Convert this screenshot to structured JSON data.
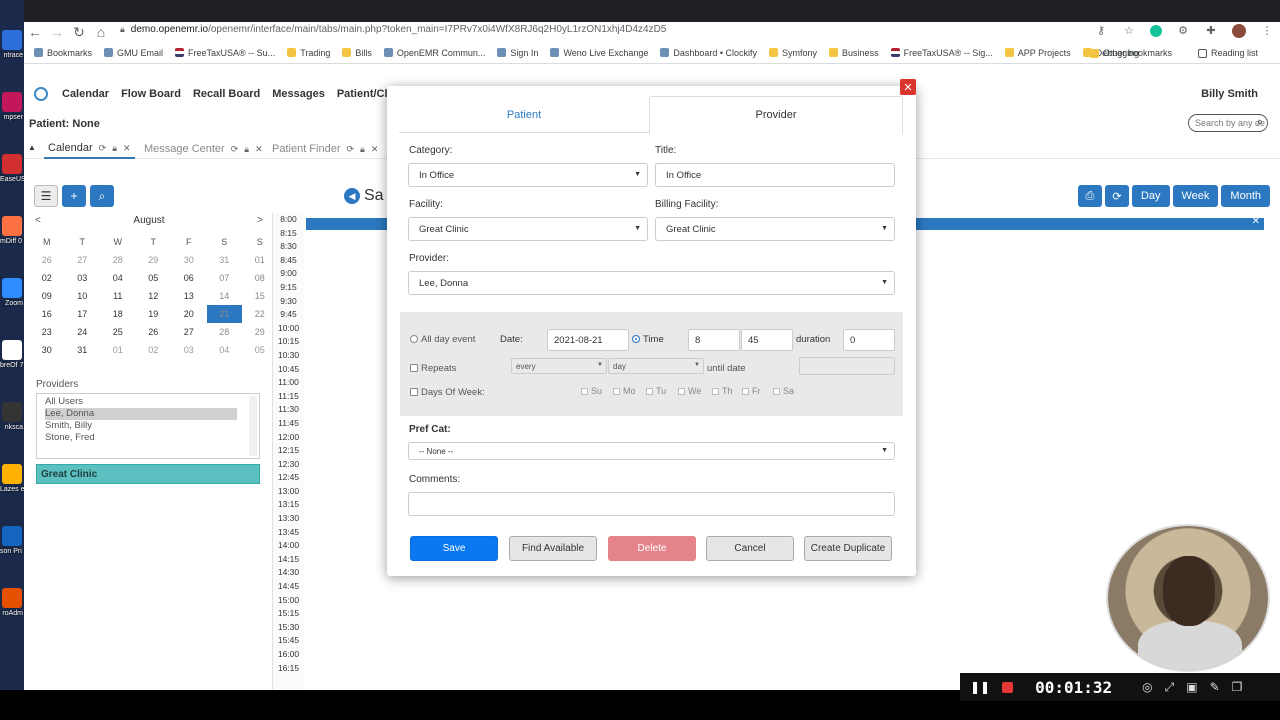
{
  "browser": {
    "url_host": "demo.openemr.io",
    "url_path": "/openemr/interface/main/tabs/main.php?token_main=I7PRv7x0i4WfX8RJ6q2H0yL1rzON1xhj4D4z4zD5",
    "bookmarks": [
      {
        "label": "Bookmarks",
        "icon": "apps-icon"
      },
      {
        "label": "GMU Email",
        "icon": "globe-icon"
      },
      {
        "label": "FreeTaxUSA® -- Su...",
        "icon": "flag-icon"
      },
      {
        "label": "Trading",
        "icon": "folder-icon"
      },
      {
        "label": "Bills",
        "icon": "folder-icon"
      },
      {
        "label": "OpenEMR Commun...",
        "icon": "openemr-icon"
      },
      {
        "label": "Sign In",
        "icon": "gear-icon"
      },
      {
        "label": "Weno Live Exchange",
        "icon": "weno-icon"
      },
      {
        "label": "Dashboard • Clockify",
        "icon": "clockify-icon"
      },
      {
        "label": "Symfony",
        "icon": "folder-icon"
      },
      {
        "label": "Business",
        "icon": "folder-icon"
      },
      {
        "label": "FreeTaxUSA® -- Sig...",
        "icon": "flag-icon"
      },
      {
        "label": "APP Projects",
        "icon": "folder-icon"
      },
      {
        "label": "Debugging",
        "icon": "folder-icon"
      }
    ],
    "other_bookmarks": "Other bookmarks",
    "reading_list": "Reading list"
  },
  "desktop": {
    "icons": [
      "ntrace",
      "mpser",
      "EaseUS\necExpe",
      "mDiff\n0 (64-",
      "Zoom",
      "breOf\n7.1",
      "nksca",
      "Lazes\necover",
      "son Pri\nnnect",
      "roAdm"
    ]
  },
  "app": {
    "menu": [
      "Calendar",
      "Flow Board",
      "Recall Board",
      "Messages",
      "Patient/Client"
    ],
    "user": "Billy Smith",
    "patient": "Patient: None",
    "search_placeholder": "Search by any de",
    "tabs": [
      {
        "label": "Calendar",
        "active": true
      },
      {
        "label": "Message Center",
        "active": false
      },
      {
        "label": "Patient Finder",
        "active": false
      }
    ],
    "day_title": "Sa",
    "view_buttons": [
      "Day",
      "Week",
      "Month"
    ],
    "mini_calendar": {
      "prev": "<",
      "next": ">",
      "month": "August",
      "dow": [
        "M",
        "T",
        "W",
        "T",
        "F",
        "S",
        "S"
      ],
      "weeks": [
        [
          "26",
          "27",
          "28",
          "29",
          "30",
          "31",
          "01"
        ],
        [
          "02",
          "03",
          "04",
          "05",
          "06",
          "07",
          "08"
        ],
        [
          "09",
          "10",
          "11",
          "12",
          "13",
          "14",
          "15"
        ],
        [
          "16",
          "17",
          "18",
          "19",
          "20",
          "21",
          "22"
        ],
        [
          "23",
          "24",
          "25",
          "26",
          "27",
          "28",
          "29"
        ],
        [
          "30",
          "31",
          "01",
          "02",
          "03",
          "04",
          "05"
        ]
      ],
      "selected": "21"
    },
    "providers_label": "Providers",
    "providers": [
      "All Users",
      "Lee, Donna",
      "Smith, Billy",
      "Stone, Fred"
    ],
    "selected_provider": "Lee, Donna",
    "facility": "Great Clinic",
    "times": [
      "8:00",
      "8:15",
      "8:30",
      "8:45",
      "9:00",
      "9:15",
      "9:30",
      "9:45",
      "10:00",
      "10:15",
      "10:30",
      "10:45",
      "11:00",
      "11:15",
      "11:30",
      "11:45",
      "12:00",
      "12:15",
      "12:30",
      "12:45",
      "13:00",
      "13:15",
      "13:30",
      "13:45",
      "14:00",
      "14:15",
      "14:30",
      "14:45",
      "15:00",
      "15:15",
      "15:30",
      "15:45",
      "16:00",
      "16:15"
    ]
  },
  "modal": {
    "tab_patient": "Patient",
    "tab_provider": "Provider",
    "category_label": "Category:",
    "category_value": "In Office",
    "title_label": "Title:",
    "title_value": "In Office",
    "facility_label": "Facility:",
    "facility_value": "Great Clinic",
    "billing_label": "Billing Facility:",
    "billing_value": "Great Clinic",
    "provider_label": "Provider:",
    "provider_value": "Lee, Donna",
    "all_day": "All day event",
    "date_label": "Date:",
    "date_value": "2021-08-21",
    "time_label": "Time",
    "hour_value": "8",
    "minute_value": "45",
    "duration_label": "duration",
    "duration_value": "0",
    "repeats_label": "Repeats",
    "every_value": "every",
    "day_value": "day",
    "until_label": "until date",
    "dow_label": "Days Of Week:",
    "dow": [
      "Su",
      "Mo",
      "Tu",
      "We",
      "Th",
      "Fr",
      "Sa"
    ],
    "pref_cat_label": "Pref Cat:",
    "pref_cat_value": "-- None --",
    "comments_label": "Comments:",
    "buttons": {
      "save": "Save",
      "find": "Find Available",
      "delete": "Delete",
      "cancel": "Cancel",
      "duplicate": "Create Duplicate"
    }
  },
  "recorder": {
    "time": "00:01:32"
  }
}
